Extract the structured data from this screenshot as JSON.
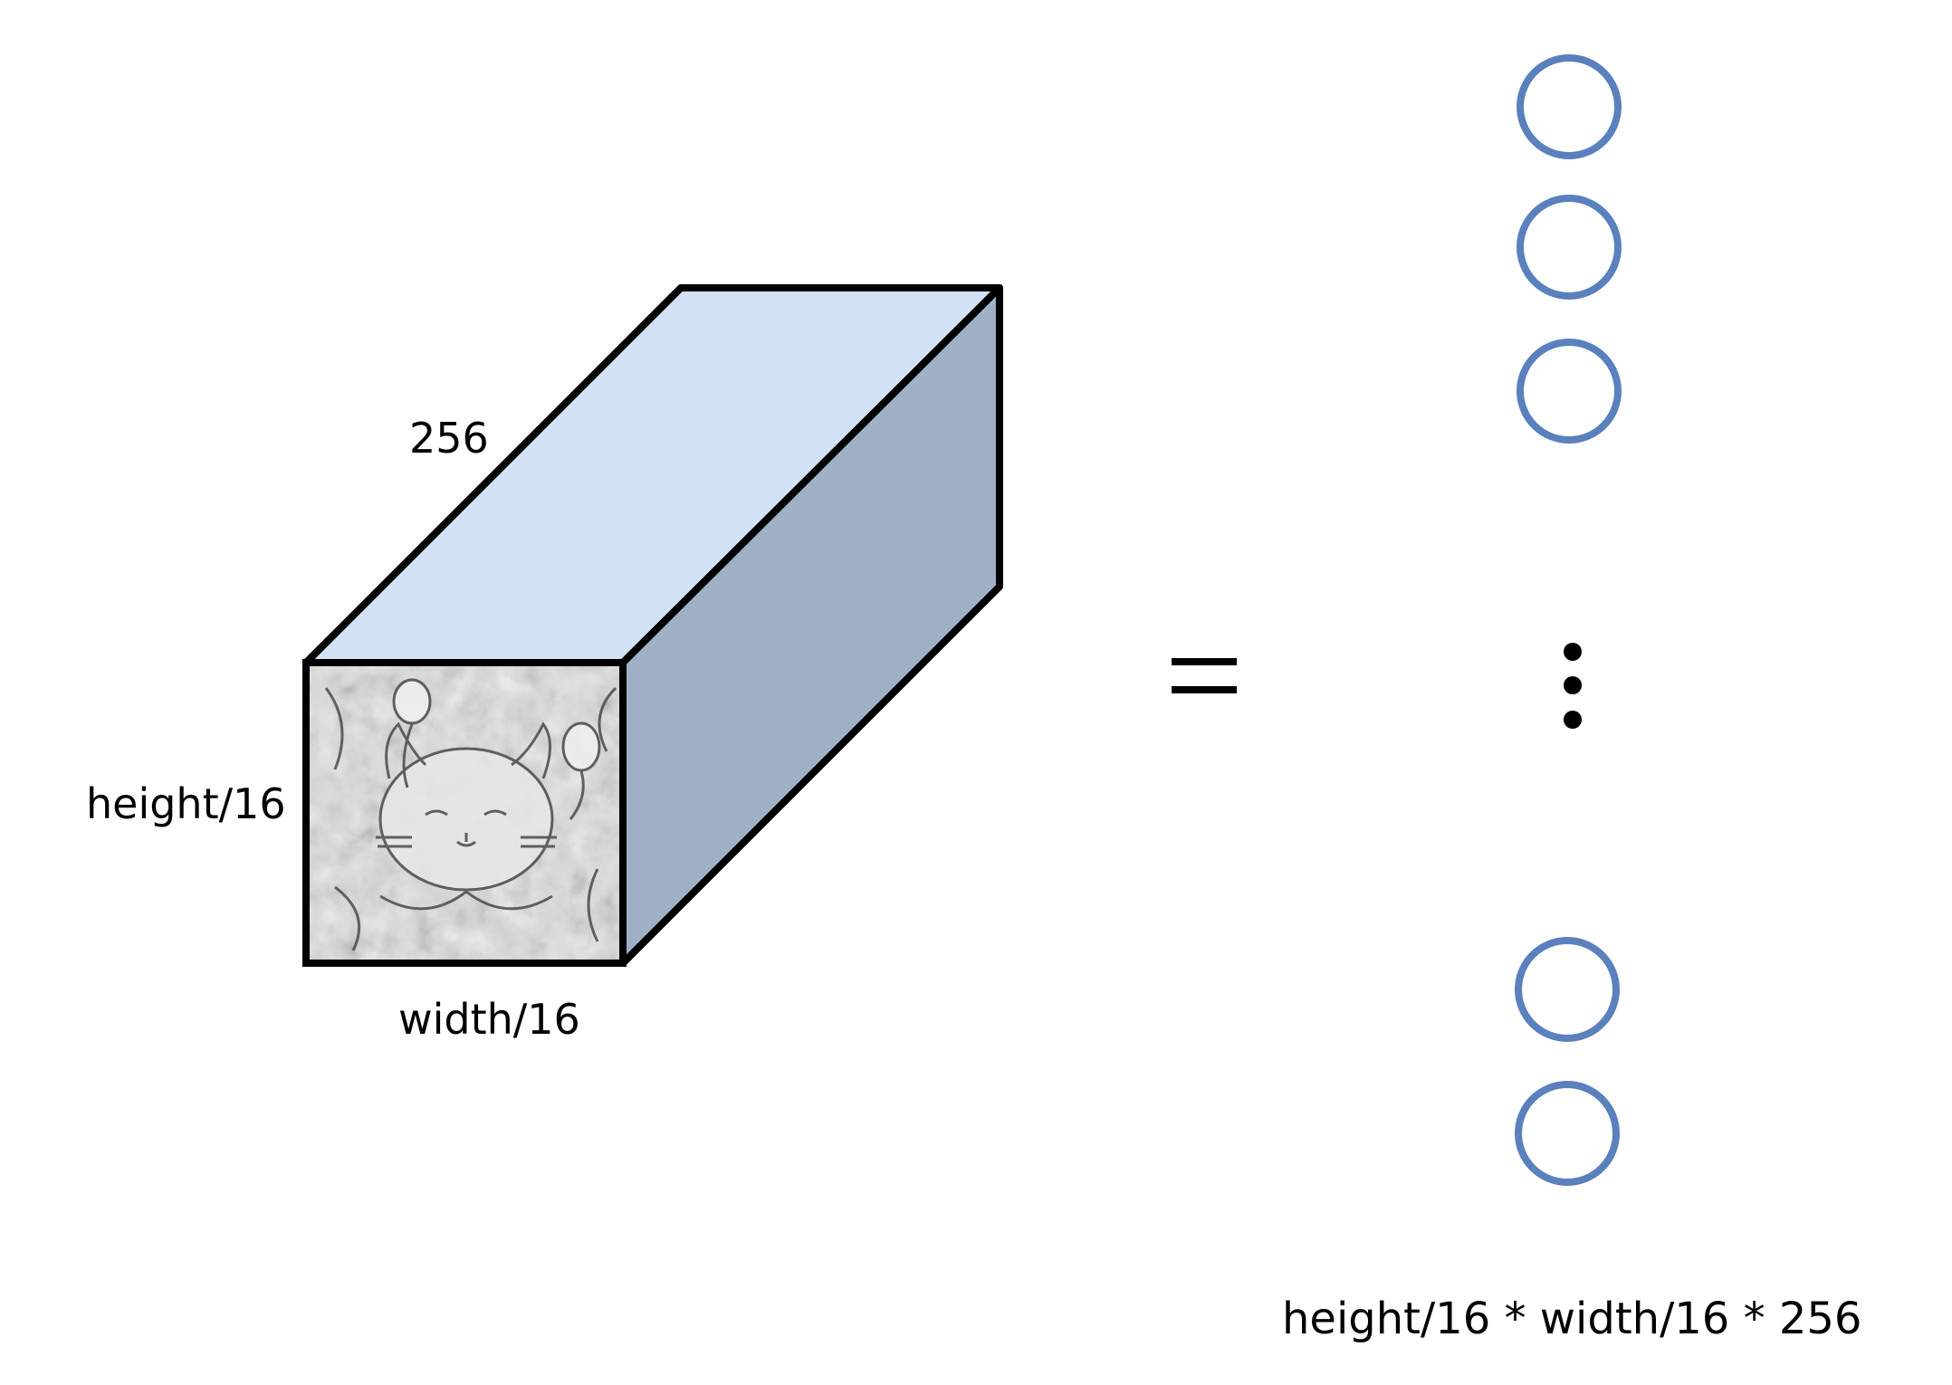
{
  "diagram": {
    "depth_label": "256",
    "height_label": "height/16",
    "width_label": "width/16",
    "equals_sign": "=",
    "ellipsis": "⋮",
    "vector_size_label": "height/16 * width/16 * 256"
  },
  "colors": {
    "top_face": "#d2e1f4",
    "side_face": "#9fb0c7",
    "edge": "#000000",
    "node_stroke": "#5a80bd"
  }
}
